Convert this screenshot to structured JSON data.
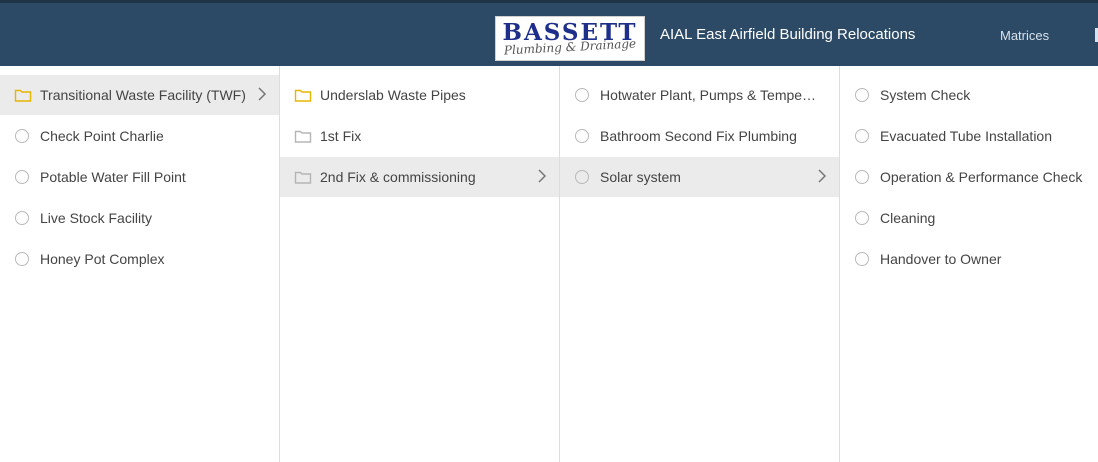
{
  "header": {
    "logo_text": "BASSETT",
    "logo_subtext": "Plumbing & Drainage",
    "title": "AIAL East Airfield Building Relocations",
    "nav_matrices": "Matrices"
  },
  "colors": {
    "header_bg": "#2c4a66",
    "selected_row_bg": "#ebebeb",
    "folder_active": "#e8b500",
    "folder_inactive": "#b5b5b5",
    "radio_border": "#b9b9b9"
  },
  "columns": [
    {
      "items": [
        {
          "label": "Transitional Waste Facility (TWF)",
          "icon": "folder-icon",
          "selected": true,
          "has_children": true
        },
        {
          "label": "Check Point Charlie",
          "icon": "radio-icon"
        },
        {
          "label": "Potable Water Fill Point",
          "icon": "radio-icon"
        },
        {
          "label": "Live Stock Facility",
          "icon": "radio-icon"
        },
        {
          "label": "Honey Pot Complex",
          "icon": "radio-icon"
        }
      ]
    },
    {
      "items": [
        {
          "label": "Underslab Waste Pipes",
          "icon": "folder-icon"
        },
        {
          "label": "1st Fix",
          "icon": "folder-icon"
        },
        {
          "label": "2nd Fix & commissioning",
          "icon": "folder-icon",
          "selected": true,
          "has_children": true
        }
      ]
    },
    {
      "items": [
        {
          "label": "Hotwater Plant, Pumps & Tempe…",
          "icon": "radio-icon"
        },
        {
          "label": "Bathroom Second Fix Plumbing",
          "icon": "radio-icon"
        },
        {
          "label": "Solar system",
          "icon": "radio-icon",
          "selected": true,
          "has_children": true
        }
      ]
    },
    {
      "items": [
        {
          "label": "System Check",
          "icon": "radio-icon"
        },
        {
          "label": "Evacuated Tube Installation",
          "icon": "radio-icon"
        },
        {
          "label": "Operation & Performance Check",
          "icon": "radio-icon"
        },
        {
          "label": "Cleaning",
          "icon": "radio-icon"
        },
        {
          "label": "Handover to Owner",
          "icon": "radio-icon"
        }
      ]
    }
  ]
}
